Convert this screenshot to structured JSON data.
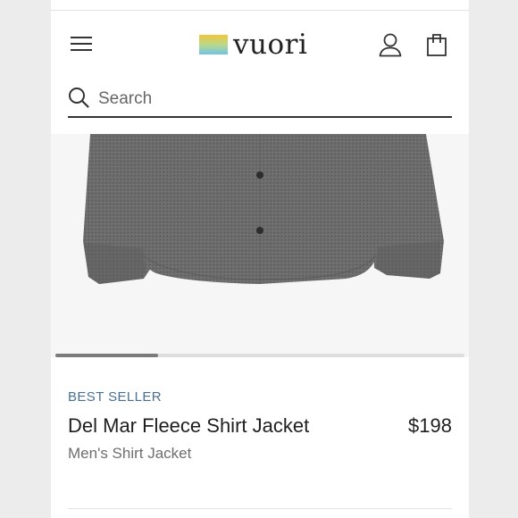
{
  "header": {
    "brand": "vuori",
    "menu_icon": "hamburger-menu-icon",
    "account_icon": "user-account-icon",
    "cart_icon": "shopping-bag-icon",
    "logo_colors": [
      "#f2c63a",
      "#7ec9e4"
    ]
  },
  "search": {
    "placeholder": "Search",
    "icon": "search-icon"
  },
  "gallery": {
    "progress": 0.25,
    "track_color": "#dedede",
    "fill_color": "#7b7b7b"
  },
  "product": {
    "badge": "BEST SELLER",
    "badge_color": "#4a6f96",
    "name": "Del Mar Fleece Shirt Jacket",
    "price": "$198",
    "subtitle": "Men's Shirt Jacket",
    "garment_color": "#6b6b6b"
  }
}
